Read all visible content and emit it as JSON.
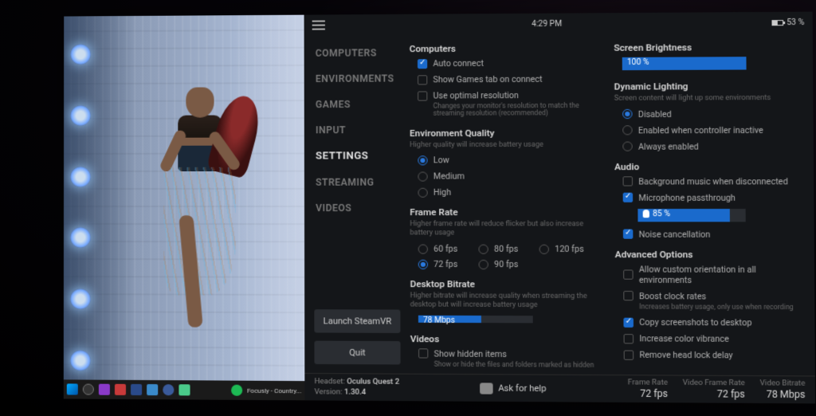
{
  "header": {
    "clock": "4:29 PM",
    "battery": "53 %"
  },
  "taskbar": {
    "now_playing": "Focusly - Country..."
  },
  "nav": {
    "items": [
      "COMPUTERS",
      "ENVIRONMENTS",
      "GAMES",
      "INPUT",
      "SETTINGS",
      "STREAMING",
      "VIDEOS"
    ],
    "active": "SETTINGS",
    "launch": "Launch SteamVR",
    "quit": "Quit"
  },
  "settings": {
    "computers": {
      "title": "Computers",
      "auto_connect": "Auto connect",
      "show_games": "Show Games tab on connect",
      "use_optimal": "Use optimal resolution",
      "use_optimal_hint": "Changes your monitor's resolution to match the streaming resolution (recommended)"
    },
    "env_quality": {
      "title": "Environment Quality",
      "hint": "Higher quality will increase battery usage",
      "low": "Low",
      "medium": "Medium",
      "high": "High"
    },
    "frame_rate": {
      "title": "Frame Rate",
      "hint": "Higher frame rate will reduce flicker but also increase battery usage",
      "o60": "60 fps",
      "o72": "72 fps",
      "o80": "80 fps",
      "o90": "90 fps",
      "o120": "120 fps"
    },
    "bitrate": {
      "title": "Desktop Bitrate",
      "hint": "Higher bitrate will increase quality when streaming the desktop but will increase battery usage",
      "value": "78 Mbps",
      "fill": 55
    },
    "videos": {
      "title": "Videos",
      "show_hidden": "Show hidden items",
      "show_hidden_hint": "Show or hide the files and folders marked as hidden"
    },
    "brightness": {
      "title": "Screen Brightness",
      "value": "100 %",
      "fill": 100
    },
    "lighting": {
      "title": "Dynamic Lighting",
      "hint": "Screen content will light up some environments",
      "disabled": "Disabled",
      "controller": "Enabled when controller inactive",
      "always": "Always enabled"
    },
    "audio": {
      "title": "Audio",
      "bg_music": "Background music when disconnected",
      "mic": "Microphone passthrough",
      "mic_value": "85 %",
      "mic_fill": 85,
      "noise": "Noise cancellation"
    },
    "advanced": {
      "title": "Advanced Options",
      "orient": "Allow custom orientation in all environments",
      "boost": "Boost clock rates",
      "boost_hint": "Increases battery usage, only use when recording",
      "screenshots": "Copy screenshots to desktop",
      "vibrance": "Increase color vibrance",
      "headlock": "Remove head lock delay"
    }
  },
  "footer": {
    "headset_label": "Headset:",
    "headset": "Oculus Quest 2",
    "version_label": "Version:",
    "version": "1.30.4",
    "help": "Ask for help",
    "stats": {
      "fr_label": "Frame Rate",
      "fr": "72 fps",
      "vfr_label": "Video Frame Rate",
      "vfr": "72 fps",
      "vb_label": "Video Bitrate",
      "vb": "78 Mbps"
    }
  }
}
